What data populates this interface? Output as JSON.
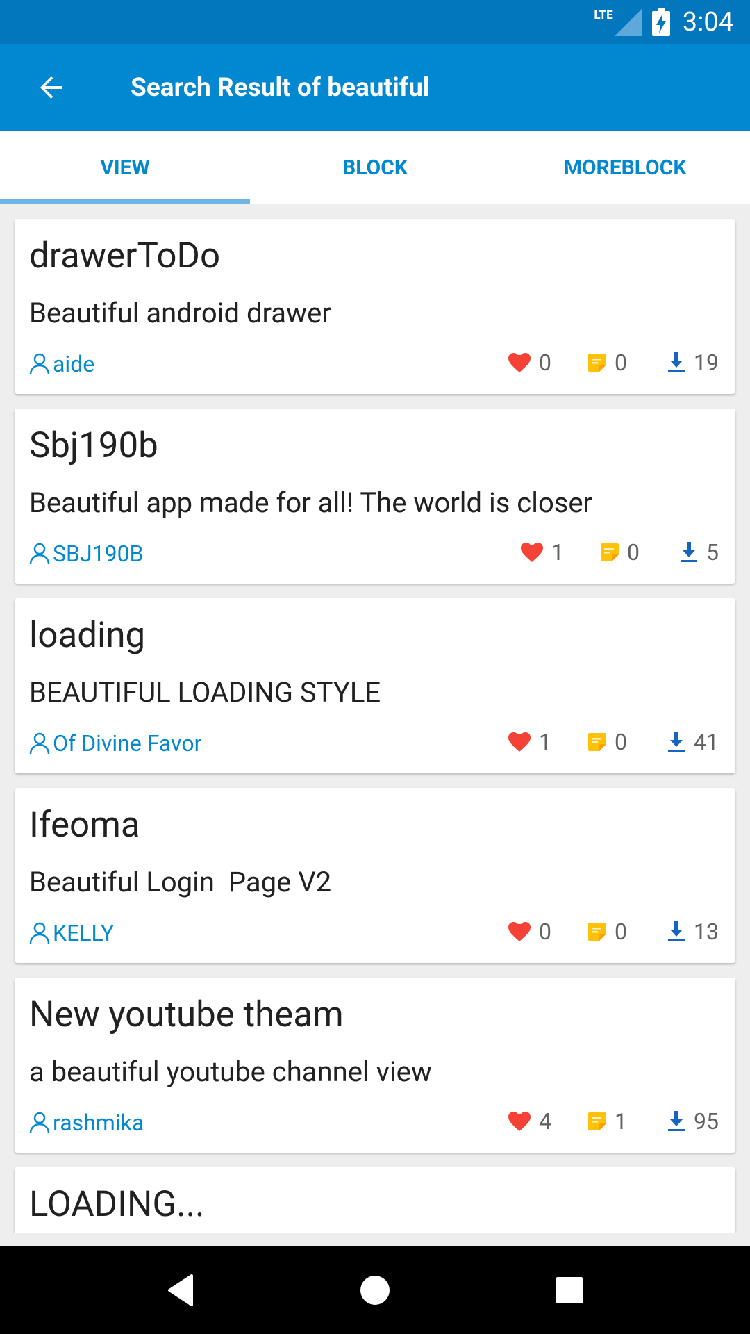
{
  "status_bar": {
    "network": "LTE",
    "time": "3:04"
  },
  "app_bar": {
    "title": "Search Result of beautiful"
  },
  "tabs": [
    {
      "label": "VIEW",
      "active": true
    },
    {
      "label": "BLOCK",
      "active": false
    },
    {
      "label": "MOREBLOCK",
      "active": false
    }
  ],
  "results": [
    {
      "name": "drawerToDo",
      "description": "Beautiful android drawer",
      "author": "aide",
      "likes": "0",
      "comments": "0",
      "downloads": "19"
    },
    {
      "name": "Sbj190b",
      "description": "Beautiful app made for all! The world is closer",
      "author": "SBJ190B",
      "likes": "1",
      "comments": "0",
      "downloads": "5"
    },
    {
      "name": "loading",
      "description": "BEAUTIFUL LOADING STYLE",
      "author": "Of Divine Favor",
      "likes": "1",
      "comments": "0",
      "downloads": "41"
    },
    {
      "name": "Ifeoma",
      "description": "Beautiful Login  Page V2",
      "author": "KELLY",
      "likes": "0",
      "comments": "0",
      "downloads": "13"
    },
    {
      "name": "New youtube theam",
      "description": "a beautiful youtube channel view",
      "author": "rashmika",
      "likes": "4",
      "comments": "1",
      "downloads": "95"
    },
    {
      "name": "LOADING...",
      "description": "",
      "author": "",
      "likes": "",
      "comments": "",
      "downloads": ""
    }
  ],
  "icons": {
    "back": "arrow-back-icon",
    "author": "person-outline-icon",
    "likes": "heart-icon",
    "comments": "note-icon",
    "downloads": "download-icon",
    "nav_back": "triangle-back-icon",
    "nav_home": "circle-home-icon",
    "nav_recents": "square-recents-icon"
  },
  "colors": {
    "status_bar": "#0277BD",
    "app_bar": "#0288D1",
    "accent": "#0288D1",
    "tab_indicator": "#6CB5E6",
    "heart": "#F44336",
    "note": "#FFC107",
    "download": "#1565C0"
  }
}
